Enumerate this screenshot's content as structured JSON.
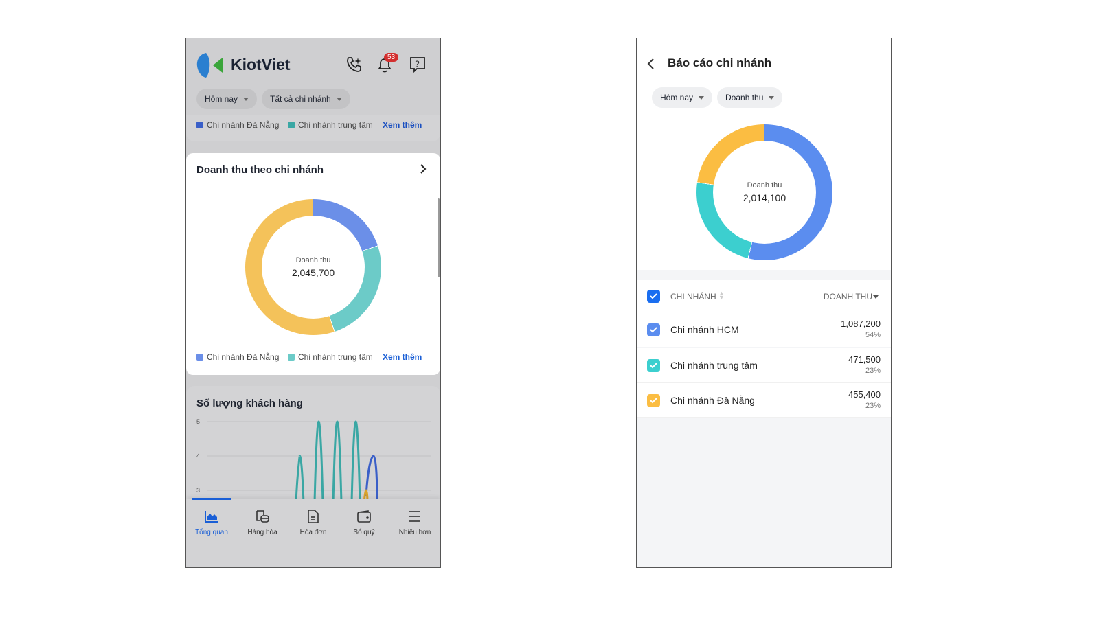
{
  "left": {
    "brand": "KiotViet",
    "notification_count": "53",
    "filters": {
      "period": "Hôm nay",
      "branch": "Tất cả chi nhánh"
    },
    "top_legend": {
      "items": [
        "Chi nhánh Đà Nẵng",
        "Chi nhánh trung tâm"
      ],
      "more": "Xem thêm"
    },
    "revenue_card": {
      "title": "Doanh thu theo chi nhánh",
      "center_label": "Doanh thu",
      "center_value": "2,045,700",
      "legend": [
        "Chi nhánh Đà Nẵng",
        "Chi nhánh trung tâm"
      ],
      "more": "Xem thêm",
      "segments": [
        {
          "color": "#6b8fe8",
          "fraction": 0.2
        },
        {
          "color": "#6ccbc8",
          "fraction": 0.25
        },
        {
          "color": "#f4c25a",
          "fraction": 0.55
        }
      ]
    },
    "customers_card": {
      "title": "Số lượng khách hàng",
      "y_ticks": [
        "5",
        "4",
        "3"
      ]
    },
    "nav": [
      {
        "label": "Tổng quan",
        "icon": "chart-icon"
      },
      {
        "label": "Hàng hóa",
        "icon": "goods-icon"
      },
      {
        "label": "Hóa đơn",
        "icon": "invoice-icon"
      },
      {
        "label": "Sổ quỹ",
        "icon": "wallet-icon"
      },
      {
        "label": "Nhiều hơn",
        "icon": "menu-icon"
      }
    ]
  },
  "right": {
    "title": "Báo cáo chi nhánh",
    "filters": {
      "period": "Hôm nay",
      "metric": "Doanh thu"
    },
    "center_label": "Doanh thu",
    "center_value": "2,014,100",
    "table": {
      "col_branch": "CHI NHÁNH",
      "col_revenue": "DOANH THU",
      "rows": [
        {
          "name": "Chi nhánh HCM",
          "value": "1,087,200",
          "pct": "54%",
          "color": "#5b8def"
        },
        {
          "name": "Chi nhánh trung tâm",
          "value": "471,500",
          "pct": "23%",
          "color": "#3ccfcf"
        },
        {
          "name": "Chi nhánh Đà Nẵng",
          "value": "455,400",
          "pct": "23%",
          "color": "#fbbd42"
        }
      ]
    }
  },
  "colors": {
    "accent": "#1a5fd6",
    "badge": "#d32f2f"
  }
}
